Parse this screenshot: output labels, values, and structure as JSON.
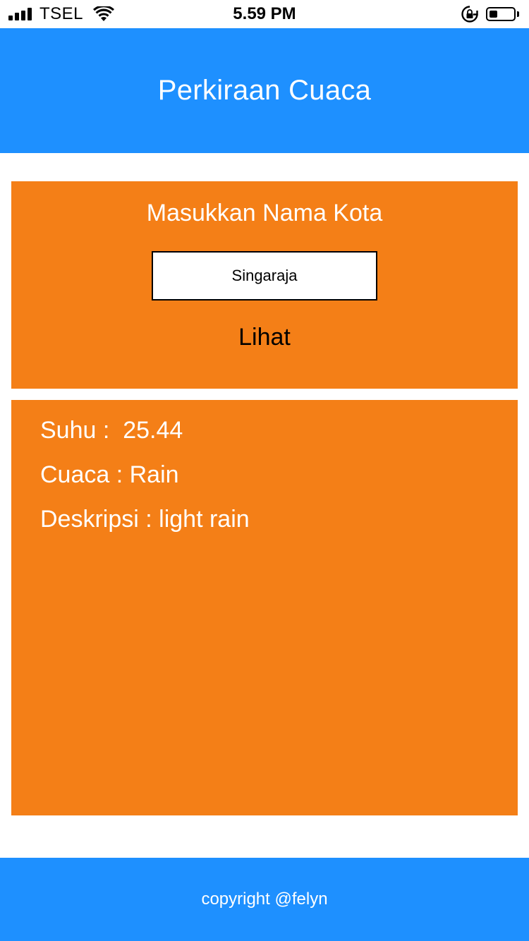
{
  "status_bar": {
    "carrier": "TSEL",
    "time": "5.59 PM",
    "signal_bars": 4,
    "battery_level": 0.35,
    "icons": [
      "signal-icon",
      "wifi-icon",
      "rotation-lock-icon",
      "battery-icon"
    ]
  },
  "header": {
    "title": "Perkiraan Cuaca"
  },
  "search": {
    "label": "Masukkan Nama Kota",
    "city_value": "Singaraja",
    "button_label": "Lihat"
  },
  "result": {
    "suhu_label": "Suhu : ",
    "suhu_value": "25.44",
    "cuaca_label": "Cuaca : ",
    "cuaca_value": "Rain",
    "deskripsi_label": "Deskripsi : ",
    "deskripsi_value": "light rain"
  },
  "footer": {
    "text": "copyright @felyn"
  },
  "colors": {
    "primary": "#1e90ff",
    "card": "#f47f17",
    "text_light": "#ffffff",
    "text_dark": "#000000"
  }
}
